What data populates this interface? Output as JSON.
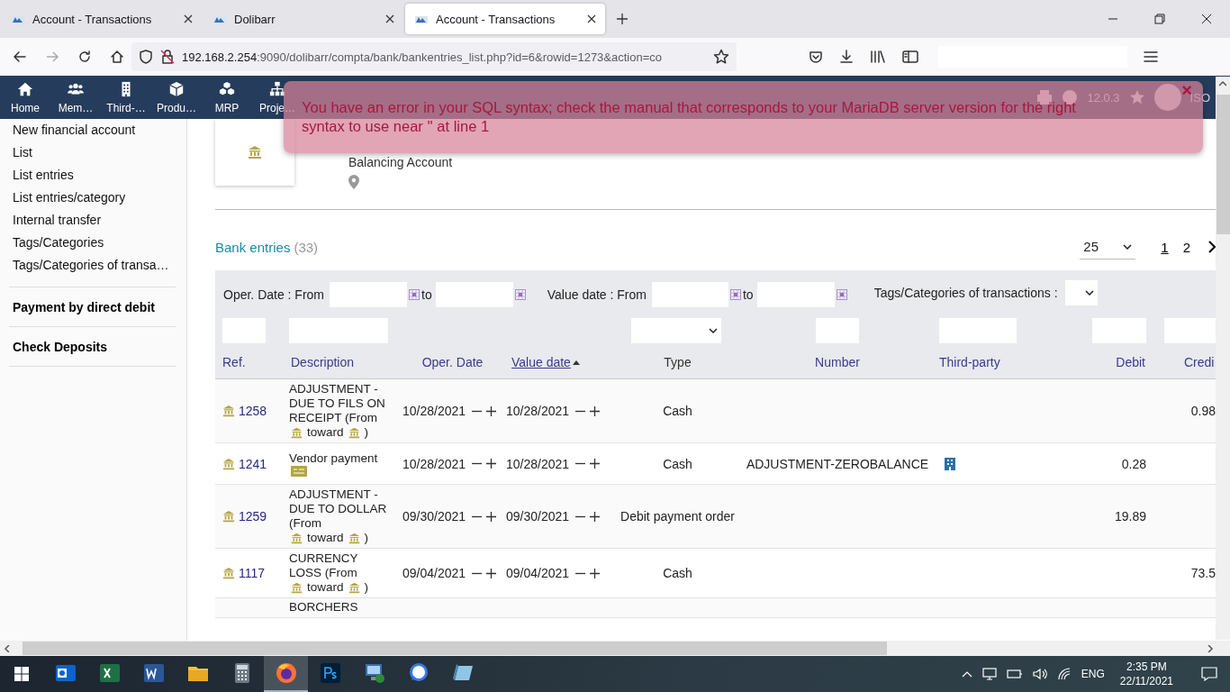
{
  "browser": {
    "tabs": [
      {
        "title": "Account - Transactions",
        "selected": false
      },
      {
        "title": "Dolibarr",
        "selected": false
      },
      {
        "title": "Account - Transactions",
        "selected": true
      }
    ],
    "url_host": "192.168.2.254",
    "url_rest": ":9090/dolibarr/compta/bank/bankentries_list.php?id=6&rowid=1273&action=co"
  },
  "top_menu": [
    {
      "label": "Home"
    },
    {
      "label": "Mem…"
    },
    {
      "label": "Third-…"
    },
    {
      "label": "Produ…"
    },
    {
      "label": "MRP"
    },
    {
      "label": "Proje…"
    }
  ],
  "top_right": {
    "version": "12.0.3",
    "user": "ISO"
  },
  "error": {
    "message": "You have an error in your SQL syntax; check the manual that corresponds to your MariaDB server version for the right syntax to use near '' at line 1",
    "close": "×"
  },
  "sidebar": {
    "items": [
      "New financial account",
      "List",
      "List entries",
      "List entries/category",
      "Internal transfer",
      "Tags/Categories",
      "Tags/Categories of transa…"
    ],
    "sections": [
      "Payment by direct debit",
      "Check Deposits"
    ]
  },
  "account": {
    "label": "Balancing Account"
  },
  "list": {
    "title": "Bank entries",
    "count": "(33)",
    "page_size": "25",
    "pages": [
      {
        "label": "1",
        "selected": true
      },
      {
        "label": "2",
        "selected": false
      }
    ]
  },
  "filters": {
    "oper_date": "Oper. Date : From",
    "oper_to": "to",
    "value_date": "Value date : From",
    "value_to": "to",
    "tags": "Tags/Categories of transactions :"
  },
  "columns": [
    {
      "label": "Ref.",
      "sortable": true,
      "sorted": false
    },
    {
      "label": "Description",
      "sortable": true,
      "sorted": false
    },
    {
      "label": "Oper. Date",
      "sortable": true,
      "sorted": false
    },
    {
      "label": "Value date",
      "sortable": true,
      "sorted": true
    },
    {
      "label": "Type",
      "sortable": false,
      "sorted": false
    },
    {
      "label": "Number",
      "sortable": true,
      "sorted": false
    },
    {
      "label": "Third-party",
      "sortable": true,
      "sorted": false
    },
    {
      "label": "Debit",
      "sortable": true,
      "sorted": false
    },
    {
      "label": "Credi",
      "sortable": true,
      "sorted": false
    }
  ],
  "rows": [
    {
      "ref": "1258",
      "description": "ADJUSTMENT - DUE TO FILS ON RECEIPT (From",
      "kind": "transfer",
      "toward": "toward",
      "end": ")",
      "oper_date": "10/28/2021",
      "value_date": "10/28/2021",
      "type": "Cash",
      "credit": "0.98"
    },
    {
      "ref": "1241",
      "description": "Vendor payment",
      "kind": "payment",
      "oper_date": "10/28/2021",
      "value_date": "10/28/2021",
      "type": "Cash",
      "number": "ADJUSTMENT-ZEROBALANCE",
      "third_party": true,
      "debit": "0.28"
    },
    {
      "ref": "1259",
      "description": "ADJUSTMENT - DUE TO DOLLAR (From",
      "kind": "transfer",
      "toward": "toward",
      "end": ")",
      "oper_date": "09/30/2021",
      "value_date": "09/30/2021",
      "type": "Debit payment order",
      "debit": "19.89"
    },
    {
      "ref": "1117",
      "description": "CURRENCY LOSS (From",
      "kind": "transfer",
      "toward": "toward",
      "end": ")",
      "oper_date": "09/04/2021",
      "value_date": "09/04/2021",
      "type": "Cash",
      "credit": "73.5"
    },
    {
      "description": "BORCHERS"
    }
  ],
  "taskbar": {
    "apps": [
      {
        "kind": "mail",
        "selected": false
      },
      {
        "kind": "sheet",
        "selected": false
      },
      {
        "kind": "doc",
        "selected": false
      },
      {
        "kind": "folder",
        "selected": false
      },
      {
        "kind": "calculator",
        "selected": false
      },
      {
        "kind": "browser",
        "selected": true
      },
      {
        "kind": "photo",
        "selected": false
      },
      {
        "kind": "remote",
        "selected": false
      },
      {
        "kind": "chat",
        "selected": false
      },
      {
        "kind": "notes",
        "selected": false
      }
    ],
    "lang": "ENG",
    "time": "2:35 PM",
    "date": "22/11/2021"
  }
}
